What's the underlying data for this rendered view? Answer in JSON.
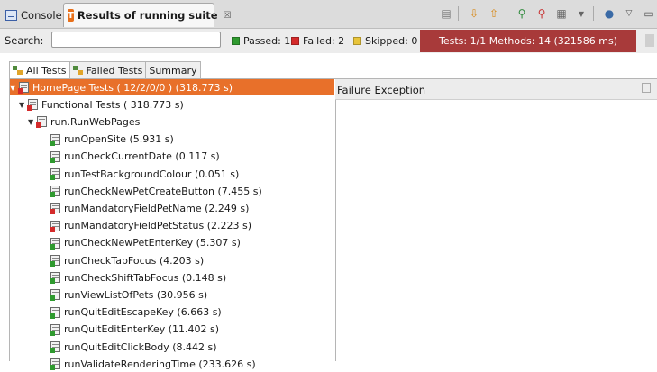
{
  "tabs": {
    "console_label": "Console",
    "results_label": "Results of running suite",
    "results_close": "☒"
  },
  "toolbar": {
    "icons": [
      "clear-icon",
      "next-failure-icon",
      "previous-failure-icon",
      "rerun-icon",
      "rerun-failed-icon",
      "layout-icon",
      "dropdown-icon",
      "globe-icon",
      "view-menu-icon",
      "minimize-icon"
    ]
  },
  "search": {
    "label": "Search:",
    "value": "",
    "placeholder": ""
  },
  "stats": {
    "passed": "Passed: 12",
    "failed": "Failed: 2",
    "skipped": "Skipped: 0",
    "passed_color": "#2f9a2f",
    "failed_color": "#d42a2a",
    "skipped_color": "#e8c43a"
  },
  "progress": {
    "text": "Tests: 1/1  Methods: 14 (321586 ms)",
    "color": "#a83a3a",
    "fraction": 1.0
  },
  "subtabs": {
    "all": "All Tests",
    "failed": "Failed Tests",
    "summary": "Summary"
  },
  "tree": [
    {
      "label": "HomePage Tests ( 12/2/0/0 ) (318.773 s)",
      "status": "fail",
      "level": 0,
      "expanded": true,
      "selected": true
    },
    {
      "label": "Functional Tests ( 318.773 s)",
      "status": "fail",
      "level": 1,
      "expanded": true,
      "selected": false
    },
    {
      "label": "run.RunWebPages",
      "status": "fail",
      "level": 2,
      "expanded": true,
      "selected": false
    },
    {
      "label": "runOpenSite (5.931 s)",
      "status": "pass",
      "level": 3
    },
    {
      "label": "runCheckCurrentDate (0.117 s)",
      "status": "pass",
      "level": 3
    },
    {
      "label": "runTestBackgroundColour (0.051 s)",
      "status": "pass",
      "level": 3
    },
    {
      "label": "runCheckNewPetCreateButton (7.455 s)",
      "status": "pass",
      "level": 3
    },
    {
      "label": "runMandatoryFieldPetName (2.249 s)",
      "status": "fail",
      "level": 3
    },
    {
      "label": "runMandatoryFieldPetStatus (2.223 s)",
      "status": "fail",
      "level": 3
    },
    {
      "label": "runCheckNewPetEnterKey (5.307 s)",
      "status": "pass",
      "level": 3
    },
    {
      "label": "runCheckTabFocus (4.203 s)",
      "status": "pass",
      "level": 3
    },
    {
      "label": "runCheckShiftTabFocus (0.148 s)",
      "status": "pass",
      "level": 3
    },
    {
      "label": "runViewListOfPets (30.956 s)",
      "status": "pass",
      "level": 3
    },
    {
      "label": "runQuitEditEscapeKey (6.663 s)",
      "status": "pass",
      "level": 3
    },
    {
      "label": "runQuitEditEnterKey (11.402 s)",
      "status": "pass",
      "level": 3
    },
    {
      "label": "runQuitEditClickBody (8.442 s)",
      "status": "pass",
      "level": 3
    },
    {
      "label": "runValidateRenderingTime (233.626 s)",
      "status": "pass",
      "level": 3
    }
  ],
  "failure": {
    "header": "Failure Exception"
  }
}
